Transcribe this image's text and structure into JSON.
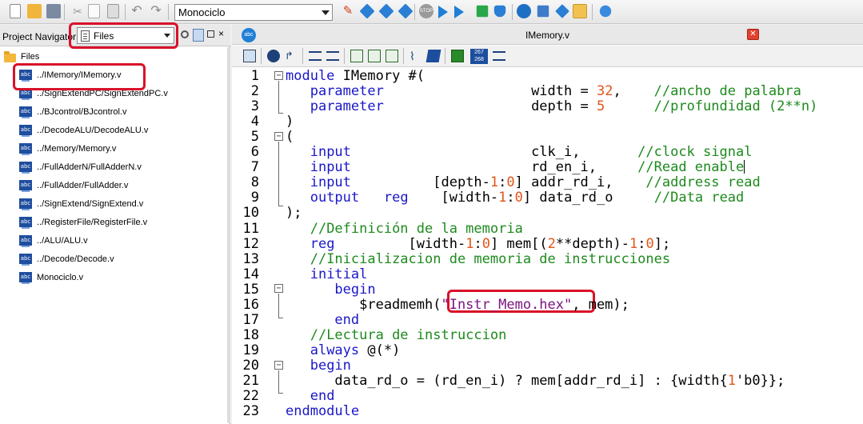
{
  "toolbar": {
    "revision_select": "Monociclo",
    "buttons": [
      "new-file",
      "open-folder",
      "save",
      "cut",
      "copy",
      "paste",
      "undo",
      "redo",
      "edit-pencil",
      "diamond-blue",
      "eye-check",
      "grid-diamonds",
      "stop",
      "play",
      "step",
      "fast-forward",
      "green-flag",
      "shield",
      "clock",
      "tree",
      "arrows",
      "waveform",
      "speech-bubble"
    ]
  },
  "navigator": {
    "title": "Project Navigator",
    "view_select": "Files",
    "root_label": "Files",
    "files": [
      "../IMemory/IMemory.v",
      "../SignExtendPC/SignExtendPC.v",
      "../BJcontrol/BJcontrol.v",
      "../DecodeALU/DecodeALU.v",
      "../Memory/Memory.v",
      "../FullAdderN/FullAdderN.v",
      "../FullAdder/FullAdder.v",
      "../SignExtend/SignExtend.v",
      "../RegisterFile/RegisterFile.v",
      "../ALU/ALU.v",
      "../Decode/Decode.v",
      "Monociclo.v"
    ],
    "icon_badge": "abc"
  },
  "editor": {
    "file_title": "IMemory.v",
    "ed_toolbar_counter_top": "267",
    "ed_toolbar_counter_bottom": "268",
    "line_numbers": [
      "1",
      "2",
      "3",
      "4",
      "5",
      "6",
      "7",
      "8",
      "9",
      "10",
      "11",
      "12",
      "13",
      "14",
      "15",
      "16",
      "17",
      "18",
      "19",
      "20",
      "21",
      "22",
      "23"
    ],
    "code_lines": [
      [
        [
          "kw",
          "module "
        ],
        [
          "t",
          "IMemory #("
        ]
      ],
      [
        [
          "t",
          "   "
        ],
        [
          "kw",
          "parameter"
        ],
        [
          "t",
          "                  width = "
        ],
        [
          "num",
          "32"
        ],
        [
          "t",
          ",    "
        ],
        [
          "cmt",
          "//ancho de palabra"
        ]
      ],
      [
        [
          "t",
          "   "
        ],
        [
          "kw",
          "parameter"
        ],
        [
          "t",
          "                  depth = "
        ],
        [
          "num",
          "5"
        ],
        [
          "t",
          "      "
        ],
        [
          "cmt",
          "//profundidad (2**n)"
        ]
      ],
      [
        [
          "t",
          ")"
        ]
      ],
      [
        [
          "t",
          "("
        ]
      ],
      [
        [
          "t",
          "   "
        ],
        [
          "kw",
          "input"
        ],
        [
          "t",
          "                      clk_i,       "
        ],
        [
          "cmt",
          "//clock signal"
        ]
      ],
      [
        [
          "t",
          "   "
        ],
        [
          "kw",
          "input"
        ],
        [
          "t",
          "                      rd_en_i,     "
        ],
        [
          "cmt",
          "//Read enable"
        ]
      ],
      [
        [
          "t",
          "   "
        ],
        [
          "kw",
          "input"
        ],
        [
          "t",
          "          [depth-"
        ],
        [
          "num",
          "1"
        ],
        [
          "t",
          ":"
        ],
        [
          "num",
          "0"
        ],
        [
          "t",
          "] addr_rd_i,    "
        ],
        [
          "cmt",
          "//address read"
        ]
      ],
      [
        [
          "t",
          "   "
        ],
        [
          "kw",
          "output"
        ],
        [
          "t",
          "   "
        ],
        [
          "kw",
          "reg"
        ],
        [
          "t",
          "    [width-"
        ],
        [
          "num",
          "1"
        ],
        [
          "t",
          ":"
        ],
        [
          "num",
          "0"
        ],
        [
          "t",
          "] data_rd_o     "
        ],
        [
          "cmt",
          "//Data read"
        ]
      ],
      [
        [
          "t",
          ");"
        ]
      ],
      [
        [
          "t",
          "   "
        ],
        [
          "cmt",
          "//Definición de la memoria"
        ]
      ],
      [
        [
          "t",
          "   "
        ],
        [
          "kw",
          "reg"
        ],
        [
          "t",
          "         [width-"
        ],
        [
          "num",
          "1"
        ],
        [
          "t",
          ":"
        ],
        [
          "num",
          "0"
        ],
        [
          "t",
          "] mem[("
        ],
        [
          "num",
          "2"
        ],
        [
          "t",
          "**depth)-"
        ],
        [
          "num",
          "1"
        ],
        [
          "t",
          ":"
        ],
        [
          "num",
          "0"
        ],
        [
          "t",
          "];"
        ]
      ],
      [
        [
          "t",
          "   "
        ],
        [
          "cmt",
          "//Inicializacion de memoria de instrucciones"
        ]
      ],
      [
        [
          "t",
          "   "
        ],
        [
          "kw",
          "initial"
        ]
      ],
      [
        [
          "t",
          "      "
        ],
        [
          "kw",
          "begin"
        ]
      ],
      [
        [
          "t",
          "         $readmemh("
        ],
        [
          "str",
          "\"Instr_Memo.hex\""
        ],
        [
          "t",
          ", mem);"
        ]
      ],
      [
        [
          "t",
          "      "
        ],
        [
          "kw",
          "end"
        ]
      ],
      [
        [
          "t",
          "   "
        ],
        [
          "cmt",
          "//Lectura de instruccion"
        ]
      ],
      [
        [
          "t",
          "   "
        ],
        [
          "kw",
          "always"
        ],
        [
          "t",
          " @(*)"
        ]
      ],
      [
        [
          "t",
          "   "
        ],
        [
          "kw",
          "begin"
        ]
      ],
      [
        [
          "t",
          "      data_rd_o = (rd_en_i) ? mem[addr_rd_i] : {width{"
        ],
        [
          "num",
          "1"
        ],
        [
          "t",
          "'b0"
        ],
        [
          "t",
          "}};"
        ]
      ],
      [
        [
          "t",
          "   "
        ],
        [
          "kw",
          "end"
        ]
      ],
      [
        [
          "kw",
          "endmodule"
        ]
      ]
    ]
  }
}
